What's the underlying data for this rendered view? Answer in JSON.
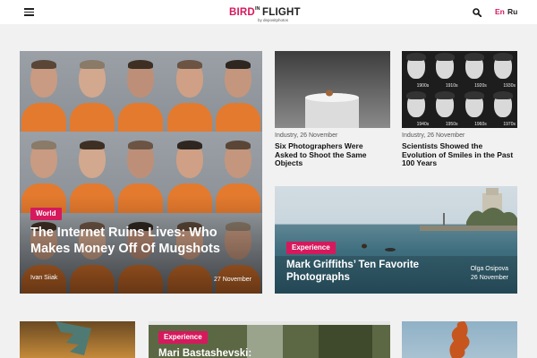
{
  "header": {
    "logo": {
      "bird": "BIRD",
      "in": "IN",
      "flight": "FLIGHT",
      "by": "by depositphotos"
    },
    "icons": {
      "menu": "menu-icon",
      "search": "search-icon"
    },
    "languages": [
      {
        "label": "En",
        "active": true
      },
      {
        "label": "Ru",
        "active": false
      }
    ]
  },
  "colors": {
    "accent": "#d6195d",
    "background": "#f1f1f1",
    "header": "#ffffff"
  },
  "featured": {
    "tag": "World",
    "title": "The Internet Ruins Lives: Who Makes Money Off Of Mugshots",
    "author": "Ivan Siiak",
    "date": "27 November"
  },
  "articles": [
    {
      "category_date": "Industry, 26 November",
      "title": "Six Photographers Were Asked to Shoot the Same Objects"
    },
    {
      "category_date": "Industry, 26 November",
      "title": "Scientists Showed the Evolution of Smiles in the Past 100 Years",
      "photo_years": [
        "1900s",
        "1910s",
        "1920s",
        "1930s",
        "1940s",
        "1950s",
        "1960s",
        "1970s"
      ]
    }
  ],
  "sea_story": {
    "tag": "Experience",
    "title": "Mark Griffiths’ Ten Favorite Photographs",
    "author": "Olga Osipova",
    "date": "26 November"
  },
  "bottom_story": {
    "tag": "Experience",
    "title": "Mari Bastashevski:"
  }
}
